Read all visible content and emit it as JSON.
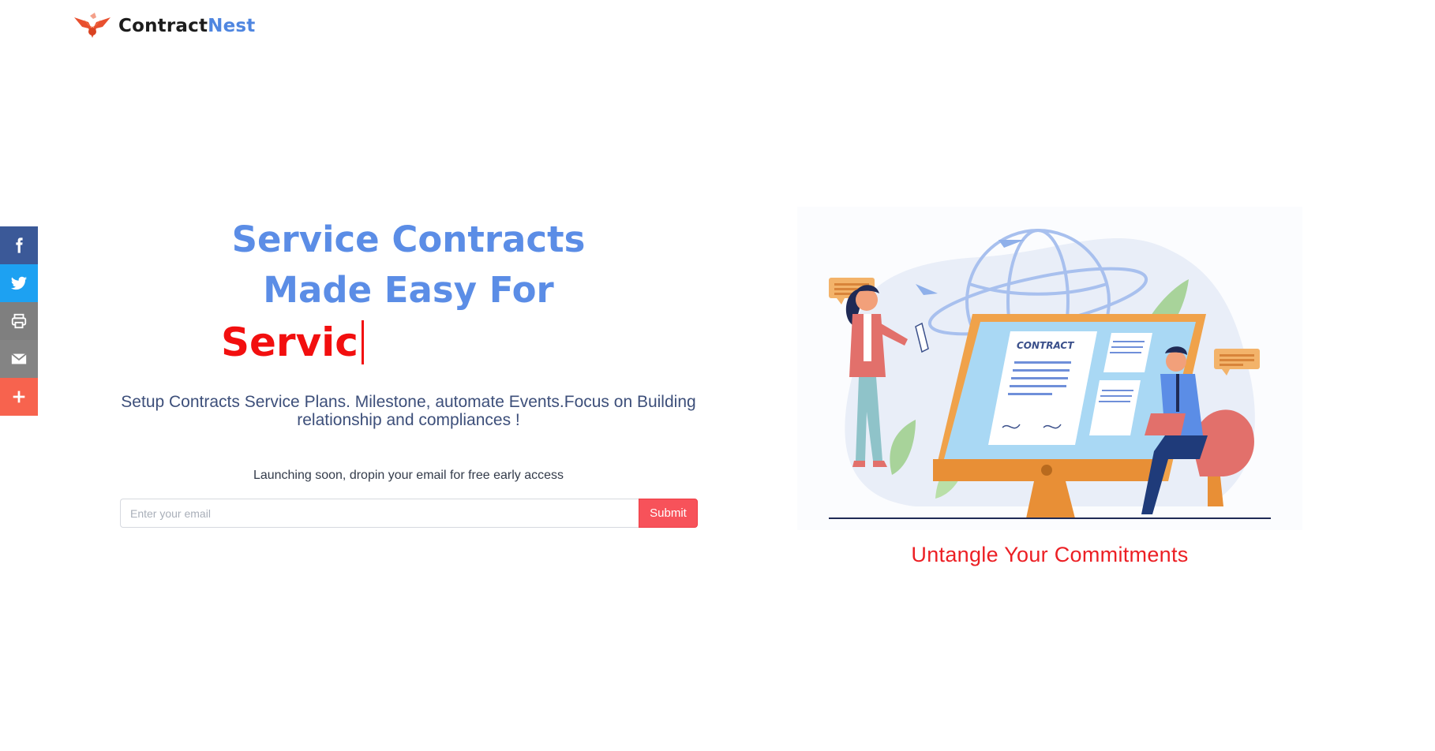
{
  "brand": {
    "name_part1": "Contract",
    "name_part2": "Nest",
    "logo_icon": "bird-logo-icon",
    "colors": {
      "primary": "#4f86e0",
      "accent_red": "#f20f0f",
      "button": "#f7525a"
    }
  },
  "share_bar": {
    "items": [
      {
        "name": "facebook",
        "icon": "facebook-icon",
        "color": "#3b5998"
      },
      {
        "name": "twitter",
        "icon": "twitter-icon",
        "color": "#1da1f2"
      },
      {
        "name": "print",
        "icon": "printer-icon",
        "color": "#7f7f7f"
      },
      {
        "name": "email",
        "icon": "mail-icon",
        "color": "#848484"
      },
      {
        "name": "more",
        "icon": "plus-icon",
        "color": "#f7634e"
      }
    ]
  },
  "hero": {
    "headline_line1": "Service Contracts",
    "headline_line2": "Made Easy For",
    "typed_text": "Servic",
    "description": "Setup Contracts Service Plans. Milestone, automate Events.Focus on Building relationship and compliances !",
    "launch_note": "Launching soon, dropin your email for free early access",
    "email_placeholder": "Enter your email",
    "email_value": "",
    "submit_label": "Submit"
  },
  "illustration": {
    "contract_label": "CONTRACT",
    "tagline": "Untangle Your Commitments"
  }
}
